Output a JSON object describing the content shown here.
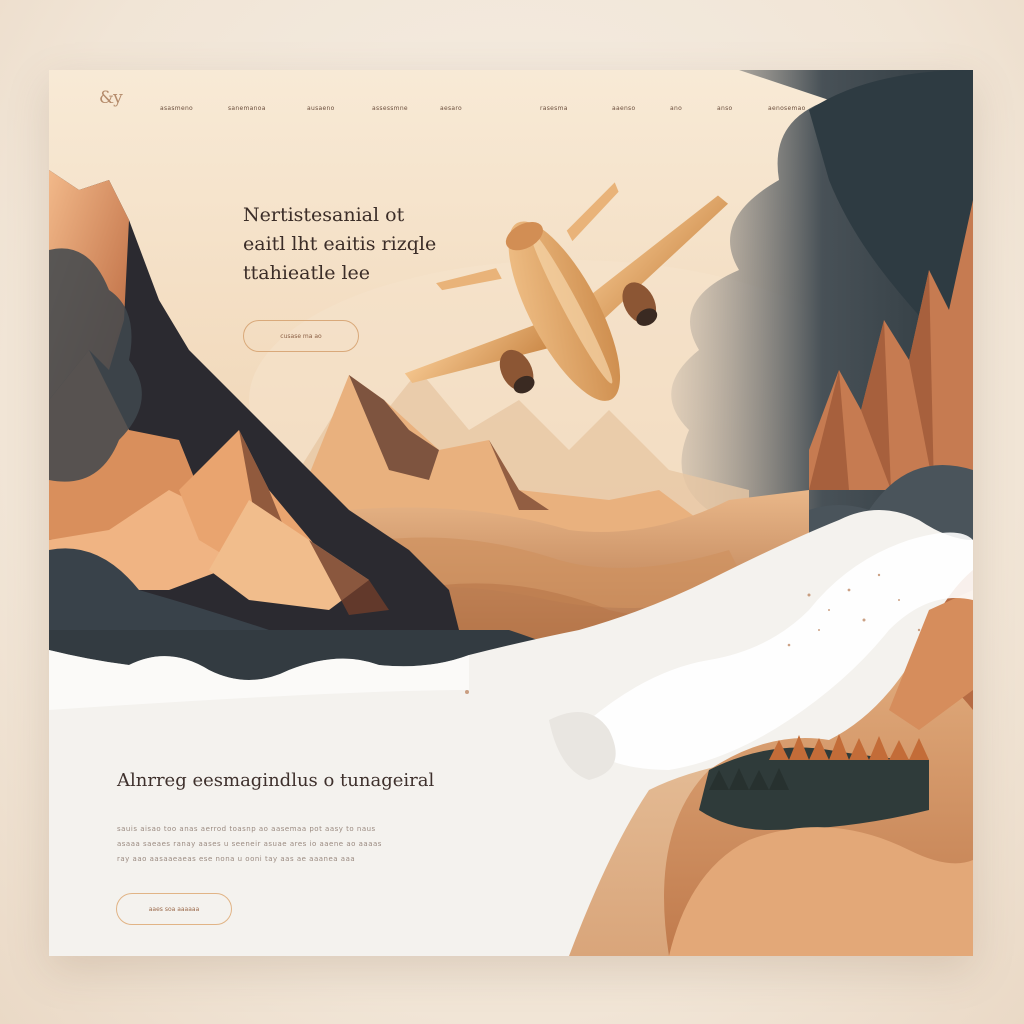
{
  "brand": {
    "logo_text": "&y"
  },
  "nav": {
    "items": [
      {
        "label": "asasmeno"
      },
      {
        "label": "sanemanoa"
      },
      {
        "label": "ausaeno"
      },
      {
        "label": "assessmne"
      },
      {
        "label": "aesaro"
      },
      {
        "label": "rasesma"
      },
      {
        "label": "aaenso"
      },
      {
        "label": "ano"
      },
      {
        "label": "anso"
      },
      {
        "label": "aenosemao"
      }
    ]
  },
  "hero": {
    "title_lines": [
      "Nertistesanial ot",
      "eaitl lht eaitis rizqle",
      "ttahieatle lee"
    ],
    "button_label": "cusase ma ao"
  },
  "section": {
    "title": "Alnrreg eesmagindlus o tunageiral",
    "body_lines": [
      "sauis aisao too anas aerrod toasnp ao aasemaa pot aasy to naus",
      "asaaa saeaes ranay aases u seeneir asuae ares io aaene ao aaaas",
      "ray aao aasaaeaeas ese nona u ooni tay aas ae aaanea aaa"
    ],
    "button_label": "aaes soa aaaaaa"
  },
  "colors": {
    "accent": "#d9a97a",
    "sky_top": "#f7e8d3",
    "mountain_light": "#e8a96e",
    "mountain_dark": "#2c2a2e",
    "cloud_dark": "#3b454b",
    "panel_white": "#f4f2ee"
  }
}
